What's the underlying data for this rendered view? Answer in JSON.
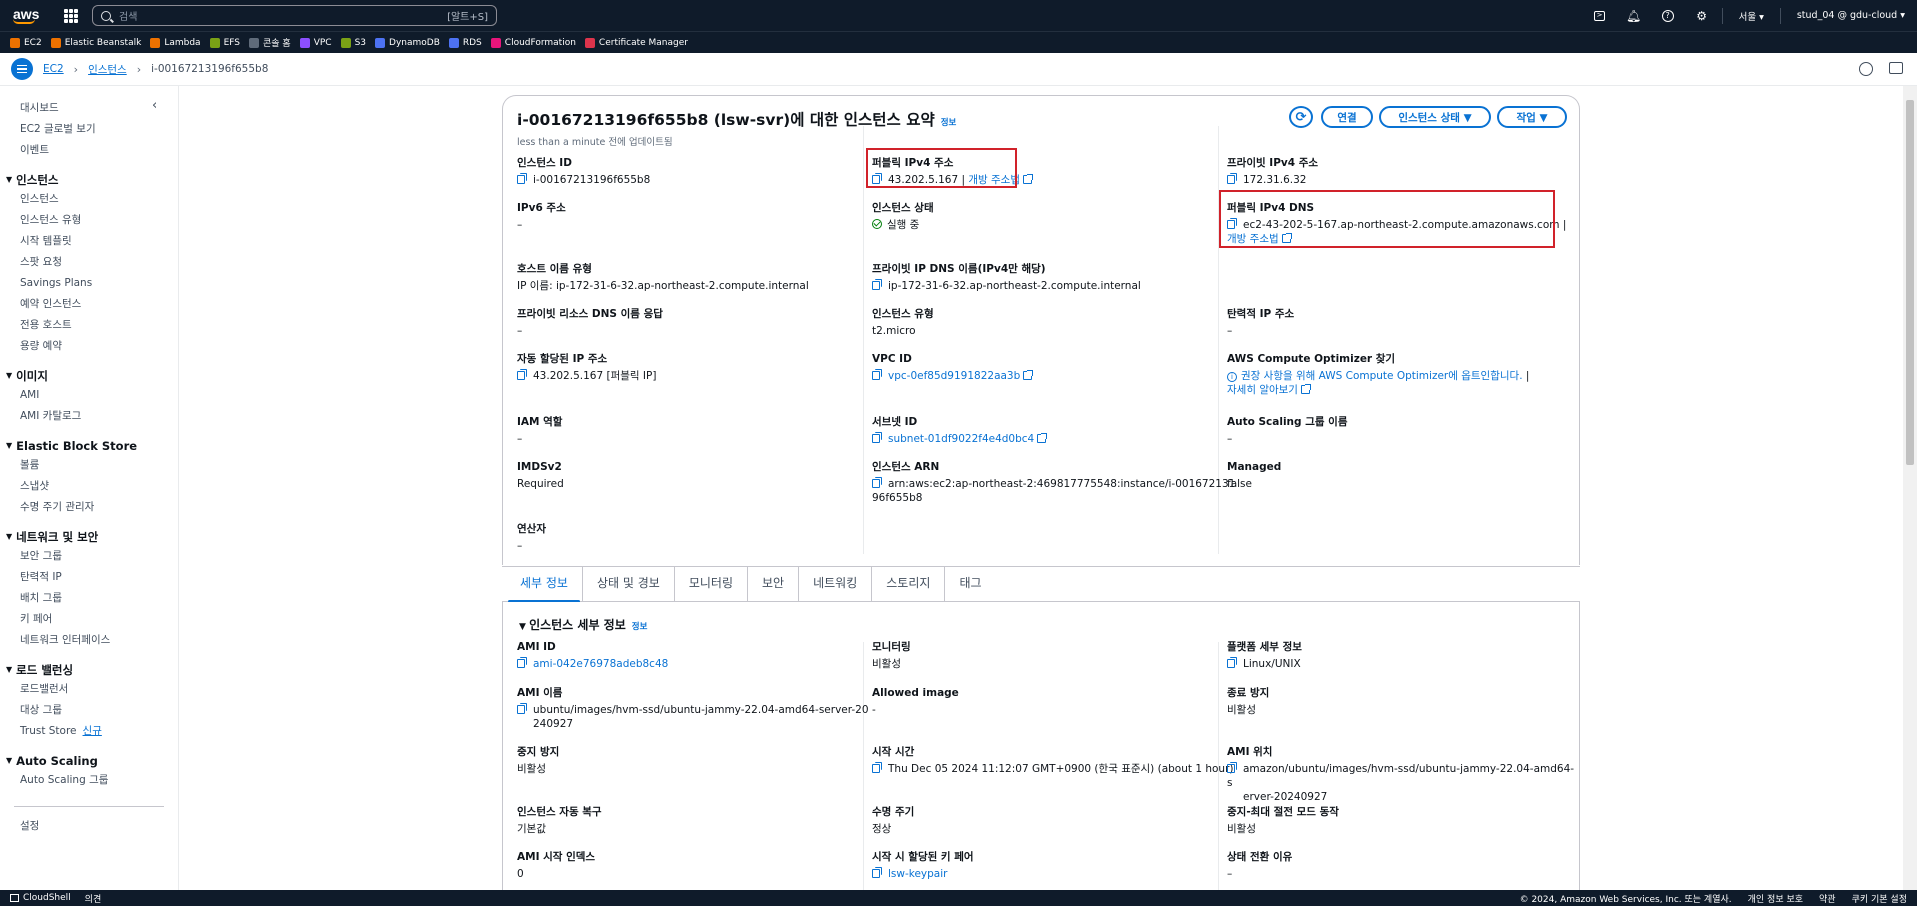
{
  "topnav": {
    "logo": "aws",
    "search_placeholder": "검색",
    "search_shortcut": "[알트+S]",
    "region": "서울 ▾",
    "account": "stud_04 @ gdu-cloud ▾",
    "icons": [
      "cloudshell-icon",
      "bell-icon",
      "help-icon",
      "gear-icon"
    ]
  },
  "favorites": [
    {
      "label": "EC2",
      "color": "#ed7100"
    },
    {
      "label": "Elastic Beanstalk",
      "color": "#ed7100"
    },
    {
      "label": "Lambda",
      "color": "#ed7100"
    },
    {
      "label": "EFS",
      "color": "#7aa116"
    },
    {
      "label": "콘솔 홈",
      "color": "#5f6b7a"
    },
    {
      "label": "VPC",
      "color": "#8c4fff"
    },
    {
      "label": "S3",
      "color": "#7aa116"
    },
    {
      "label": "DynamoDB",
      "color": "#4d72f3"
    },
    {
      "label": "RDS",
      "color": "#4d72f3"
    },
    {
      "label": "CloudFormation",
      "color": "#e7157b"
    },
    {
      "label": "Certificate Manager",
      "color": "#dd344c"
    }
  ],
  "breadcrumb": {
    "items": [
      "EC2",
      "인스턴스"
    ],
    "current": "i-00167213196f655b8"
  },
  "sidebar": {
    "top": [
      "대시보드",
      "EC2 글로벌 보기",
      "이벤트"
    ],
    "sections": [
      {
        "title": "인스턴스",
        "items": [
          "인스턴스",
          "인스턴스 유형",
          "시작 템플릿",
          "스팟 요청",
          "Savings Plans",
          "예약 인스턴스",
          "전용 호스트",
          "용량 예약"
        ]
      },
      {
        "title": "이미지",
        "items": [
          "AMI",
          "AMI 카탈로그"
        ]
      },
      {
        "title": "Elastic Block Store",
        "items": [
          "볼륨",
          "스냅샷",
          "수명 주기 관리자"
        ]
      },
      {
        "title": "네트워크 및 보안",
        "items": [
          "보안 그룹",
          "탄력적 IP",
          "배치 그룹",
          "키 페어",
          "네트워크 인터페이스"
        ]
      },
      {
        "title": "로드 밸런싱",
        "items": [
          "로드밸런서",
          "대상 그룹",
          "Trust Store"
        ]
      },
      {
        "title": "Auto Scaling",
        "items": [
          "Auto Scaling 그룹"
        ]
      }
    ],
    "new_badge": "신규",
    "settings": "설정"
  },
  "summary": {
    "title": "i-00167213196f655b8 (lsw-svr)에 대한 인스턴스 요약",
    "info": "정보",
    "subtitle": "less than a minute 전에 업데이트됨",
    "buttons": {
      "connect": "연결",
      "state": "인스턴스 상태 ▼",
      "actions": "작업 ▼"
    },
    "instance_id": {
      "label": "인스턴스 ID",
      "value": "i-00167213196f655b8"
    },
    "public_ipv4": {
      "label": "퍼블릭 IPv4 주소",
      "value": "43.202.5.167 |",
      "link": "개방 주소법"
    },
    "private_ipv4": {
      "label": "프라이빗 IPv4 주소",
      "value": "172.31.6.32"
    },
    "ipv6": {
      "label": "IPv6 주소",
      "value": "–"
    },
    "state": {
      "label": "인스턴스 상태",
      "value": "실행 중"
    },
    "public_dns": {
      "label": "퍼블릭 IPv4 DNS",
      "value": "ec2-43-202-5-167.ap-northeast-2.compute.amazonaws.com |",
      "link": "개방 주소법"
    },
    "hostname_type": {
      "label": "호스트 이름 유형",
      "value": "IP 이름: ip-172-31-6-32.ap-northeast-2.compute.internal"
    },
    "private_dns": {
      "label": "프라이빗 IP DNS 이름(IPv4만 해당)",
      "value": "ip-172-31-6-32.ap-northeast-2.compute.internal"
    },
    "private_resource_dns": {
      "label": "프라이빗 리소스 DNS 이름 응답",
      "value": "–"
    },
    "instance_type": {
      "label": "인스턴스 유형",
      "value": "t2.micro"
    },
    "elastic_ip": {
      "label": "탄력적 IP 주소",
      "value": "–"
    },
    "auto_ip": {
      "label": "자동 할당된 IP 주소",
      "value": "43.202.5.167 [퍼블릭 IP]"
    },
    "vpc": {
      "label": "VPC ID",
      "value": "vpc-0ef85d9191822aa3b"
    },
    "optimizer": {
      "label": "AWS Compute Optimizer 찾기",
      "value": "권장 사항을 위해 AWS Compute Optimizer에 옵트인합니다.",
      "sep": "|",
      "link": "자세히 알아보기"
    },
    "iam": {
      "label": "IAM 역할",
      "value": "–"
    },
    "subnet": {
      "label": "서브넷 ID",
      "value": "subnet-01df9022f4e4d0bc4"
    },
    "asg": {
      "label": "Auto Scaling 그룹 이름",
      "value": "–"
    },
    "imdsv2": {
      "label": "IMDSv2",
      "value": "Required"
    },
    "arn": {
      "label": "인스턴스 ARN",
      "value1": "arn:aws:ec2:ap-northeast-2:469817775548:instance/i-001672131",
      "value2": "96f655b8"
    },
    "managed": {
      "label": "Managed",
      "value": "false"
    },
    "operator": {
      "label": "연산자",
      "value": "–"
    }
  },
  "tabs": [
    "세부 정보",
    "상태 및 경보",
    "모니터링",
    "보안",
    "네트워킹",
    "스토리지",
    "태그"
  ],
  "details": {
    "title": "인스턴스 세부 정보",
    "info": "정보",
    "ami_id": {
      "label": "AMI ID",
      "value": "ami-042e76978adeb8c48"
    },
    "monitoring": {
      "label": "모니터링",
      "value": "비활성"
    },
    "platform": {
      "label": "플랫폼 세부 정보",
      "value": "Linux/UNIX"
    },
    "ami_name": {
      "label": "AMI 이름",
      "value1": "ubuntu/images/hvm-ssd/ubuntu-jammy-22.04-amd64-server-20",
      "value2": "240927"
    },
    "allowed_image": {
      "label": "Allowed image",
      "value": "-"
    },
    "termination": {
      "label": "종료 방지",
      "value": "비활성"
    },
    "stop_protection": {
      "label": "중지 방지",
      "value": "비활성"
    },
    "launch_time": {
      "label": "시작 시간",
      "value": "Thu Dec 05 2024 11:12:07 GMT+0900 (한국 표준시) (about 1 hour)"
    },
    "ami_location": {
      "label": "AMI 위치",
      "value1": "amazon/ubuntu/images/hvm-ssd/ubuntu-jammy-22.04-amd64-s",
      "value2": "erver-20240927"
    },
    "auto_recovery": {
      "label": "인스턴스 자동 복구",
      "value": "기본값"
    },
    "lifecycle": {
      "label": "수명 주기",
      "value": "정상"
    },
    "hibernate": {
      "label": "중지-최대 절전 모드 동작",
      "value": "비활성"
    },
    "ami_launch_index": {
      "label": "AMI 시작 인덱스",
      "value": "0"
    },
    "key_pair": {
      "label": "시작 시 할당된 키 페어",
      "value": "lsw-keypair"
    },
    "state_reason": {
      "label": "상태 전환 이유",
      "value": "–"
    }
  },
  "footer": {
    "cloudshell": "CloudShell",
    "feedback": "의견",
    "copyright": "© 2024, Amazon Web Services, Inc. 또는 계열사.",
    "privacy": "개인 정보 보호",
    "terms": "약관",
    "cookies": "쿠키 기본 설정"
  }
}
